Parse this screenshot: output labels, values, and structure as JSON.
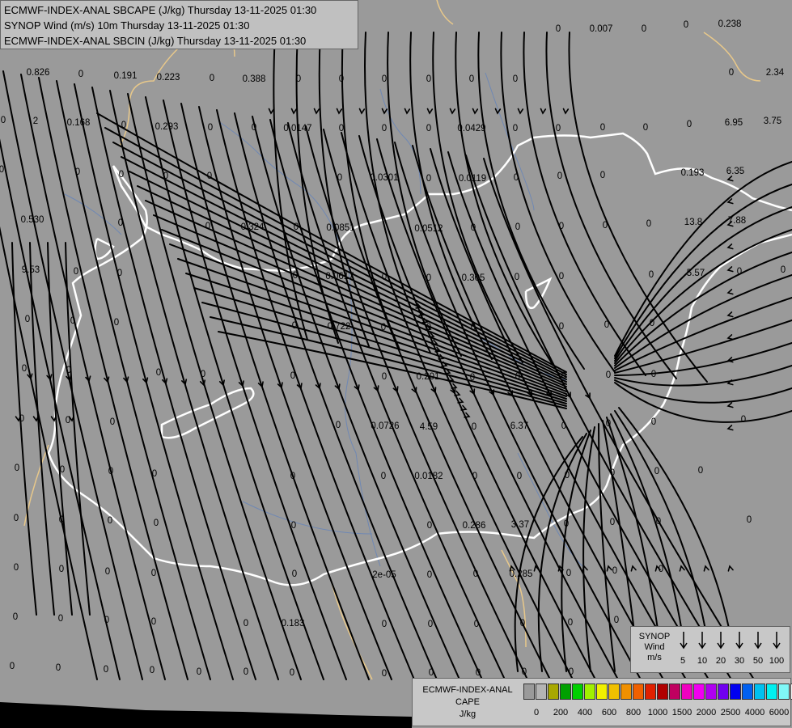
{
  "titles": [
    "ECMWF-INDEX-ANAL SBCAPE (J/kg) Thursday 13-11-2025 01:30",
    "SYNOP Wind (m/s) 10m Thursday 13-11-2025 01:30",
    "ECMWF-INDEX-ANAL SBCIN (J/kg) Thursday 13-11-2025 01:30"
  ],
  "colors": {
    "background": "#9a9a9a",
    "country_border": "#ffffff",
    "region_border": "#e8c88a",
    "river": "#6f88b4",
    "streamline": "#000000",
    "sea": "#000000"
  },
  "values": [
    {
      "text": "0.826"
    },
    {
      "text": "0"
    },
    {
      "text": "0.191"
    },
    {
      "text": "0.223"
    },
    {
      "text": "0"
    },
    {
      "text": "0.388"
    },
    {
      "text": "0"
    },
    {
      "text": "0"
    },
    {
      "text": "0"
    },
    {
      "text": "0"
    },
    {
      "text": "0"
    },
    {
      "text": "0"
    },
    {
      "text": "0"
    },
    {
      "text": "0.007"
    },
    {
      "text": "0"
    },
    {
      "text": "0"
    },
    {
      "text": "0.238"
    },
    {
      "text": "0"
    },
    {
      "text": "2"
    },
    {
      "text": "0.168"
    },
    {
      "text": "0"
    },
    {
      "text": "0.293"
    },
    {
      "text": "0"
    },
    {
      "text": "0"
    },
    {
      "text": "0.0147"
    },
    {
      "text": "0"
    },
    {
      "text": "0"
    },
    {
      "text": "0"
    },
    {
      "text": "0.0429"
    },
    {
      "text": "0"
    },
    {
      "text": "0"
    },
    {
      "text": "0"
    },
    {
      "text": "0"
    },
    {
      "text": "0"
    },
    {
      "text": "2.34"
    },
    {
      "text": "0"
    },
    {
      "text": "0"
    },
    {
      "text": "0"
    },
    {
      "text": "0"
    },
    {
      "text": "0"
    },
    {
      "text": "0"
    },
    {
      "text": "0.0301"
    },
    {
      "text": "0"
    },
    {
      "text": "0.0119"
    },
    {
      "text": "0"
    },
    {
      "text": "0"
    },
    {
      "text": "0"
    },
    {
      "text": "0"
    },
    {
      "text": "6.95"
    },
    {
      "text": "3.75"
    },
    {
      "text": "0.530"
    },
    {
      "text": "0"
    },
    {
      "text": "0"
    },
    {
      "text": "0.324"
    },
    {
      "text": "0"
    },
    {
      "text": "0.0851"
    },
    {
      "text": "0.0512"
    },
    {
      "text": "0"
    },
    {
      "text": "0"
    },
    {
      "text": "0"
    },
    {
      "text": "0"
    },
    {
      "text": "0"
    },
    {
      "text": "0.193"
    },
    {
      "text": "6.35"
    },
    {
      "text": "13.8"
    },
    {
      "text": "7.88"
    },
    {
      "text": "9.53"
    },
    {
      "text": "0"
    },
    {
      "text": "0"
    },
    {
      "text": "0"
    },
    {
      "text": "0.0617"
    },
    {
      "text": "0"
    },
    {
      "text": "0"
    },
    {
      "text": "0.305"
    },
    {
      "text": "0"
    },
    {
      "text": "0"
    },
    {
      "text": "0"
    },
    {
      "text": "5.57"
    },
    {
      "text": "0"
    },
    {
      "text": "0"
    },
    {
      "text": "0"
    },
    {
      "text": "0"
    },
    {
      "text": "0"
    },
    {
      "text": "0"
    },
    {
      "text": "0.722"
    },
    {
      "text": "0"
    },
    {
      "text": "0"
    },
    {
      "text": "0"
    },
    {
      "text": "0"
    },
    {
      "text": "0"
    },
    {
      "text": "0"
    },
    {
      "text": "0"
    },
    {
      "text": "0"
    },
    {
      "text": "0"
    },
    {
      "text": "0"
    },
    {
      "text": "0"
    },
    {
      "text": "0"
    },
    {
      "text": "0.201"
    },
    {
      "text": "0"
    },
    {
      "text": "0"
    },
    {
      "text": "0"
    },
    {
      "text": "0"
    },
    {
      "text": "0"
    },
    {
      "text": "0"
    },
    {
      "text": "0"
    },
    {
      "text": "0"
    },
    {
      "text": "0"
    },
    {
      "text": "0.0726"
    },
    {
      "text": "4.59"
    },
    {
      "text": "0"
    },
    {
      "text": "6.37"
    },
    {
      "text": "0"
    },
    {
      "text": "0"
    },
    {
      "text": "0"
    },
    {
      "text": "0"
    },
    {
      "text": "0"
    },
    {
      "text": "0"
    },
    {
      "text": "0"
    },
    {
      "text": "0"
    },
    {
      "text": "0"
    },
    {
      "text": "0"
    },
    {
      "text": "0.0182"
    },
    {
      "text": "0"
    },
    {
      "text": "0"
    },
    {
      "text": "0"
    },
    {
      "text": "0"
    },
    {
      "text": "0"
    },
    {
      "text": "0"
    },
    {
      "text": "0"
    },
    {
      "text": "0"
    },
    {
      "text": "0"
    },
    {
      "text": "0"
    },
    {
      "text": "0"
    },
    {
      "text": "0"
    },
    {
      "text": "0.286"
    },
    {
      "text": "3.37"
    },
    {
      "text": "0"
    },
    {
      "text": "0"
    },
    {
      "text": "0"
    },
    {
      "text": "0"
    },
    {
      "text": "0"
    },
    {
      "text": "0"
    },
    {
      "text": "0"
    },
    {
      "text": "0"
    },
    {
      "text": "0"
    },
    {
      "text": "2e-05"
    },
    {
      "text": "0"
    },
    {
      "text": "0"
    },
    {
      "text": "0.285"
    },
    {
      "text": "0"
    },
    {
      "text": "0"
    },
    {
      "text": "0"
    },
    {
      "text": "0"
    },
    {
      "text": "0"
    },
    {
      "text": "0"
    },
    {
      "text": "0"
    },
    {
      "text": "0"
    },
    {
      "text": "0.183"
    },
    {
      "text": "0"
    },
    {
      "text": "0"
    },
    {
      "text": "0"
    },
    {
      "text": "0"
    },
    {
      "text": "0"
    },
    {
      "text": "0"
    },
    {
      "text": "0"
    },
    {
      "text": "0"
    },
    {
      "text": "0"
    },
    {
      "text": "0"
    },
    {
      "text": "0"
    },
    {
      "text": "0"
    },
    {
      "text": "0"
    },
    {
      "text": "0"
    },
    {
      "text": "0"
    },
    {
      "text": "0"
    },
    {
      "text": "0"
    },
    {
      "text": "0"
    },
    {
      "text": "0"
    }
  ],
  "synop_legend": {
    "title_lines": [
      "SYNOP",
      "Wind",
      "m/s"
    ],
    "arrow_icon": "down-arrow-icon",
    "speeds": [
      "5",
      "10",
      "20",
      "30",
      "50",
      "100"
    ]
  },
  "cape_legend": {
    "title_lines": [
      "ECMWF-INDEX-ANAL",
      "CAPE",
      "J/kg"
    ],
    "colors": [
      "#9a9a9a",
      "#b4b4b4",
      "#a8a800",
      "#00a000",
      "#00d000",
      "#a0f000",
      "#f0f000",
      "#f0c000",
      "#f09000",
      "#f06000",
      "#e02000",
      "#b00000",
      "#c00060",
      "#f000c0",
      "#f000f0",
      "#b000f0",
      "#7000f0",
      "#0000f0",
      "#0060f0",
      "#00c0f0",
      "#00f0f0",
      "#80f8f8",
      "#ffffff"
    ],
    "ticks": [
      "0",
      "200",
      "400",
      "600",
      "800",
      "1000",
      "1500",
      "2000",
      "2500",
      "4000",
      "6000"
    ]
  }
}
